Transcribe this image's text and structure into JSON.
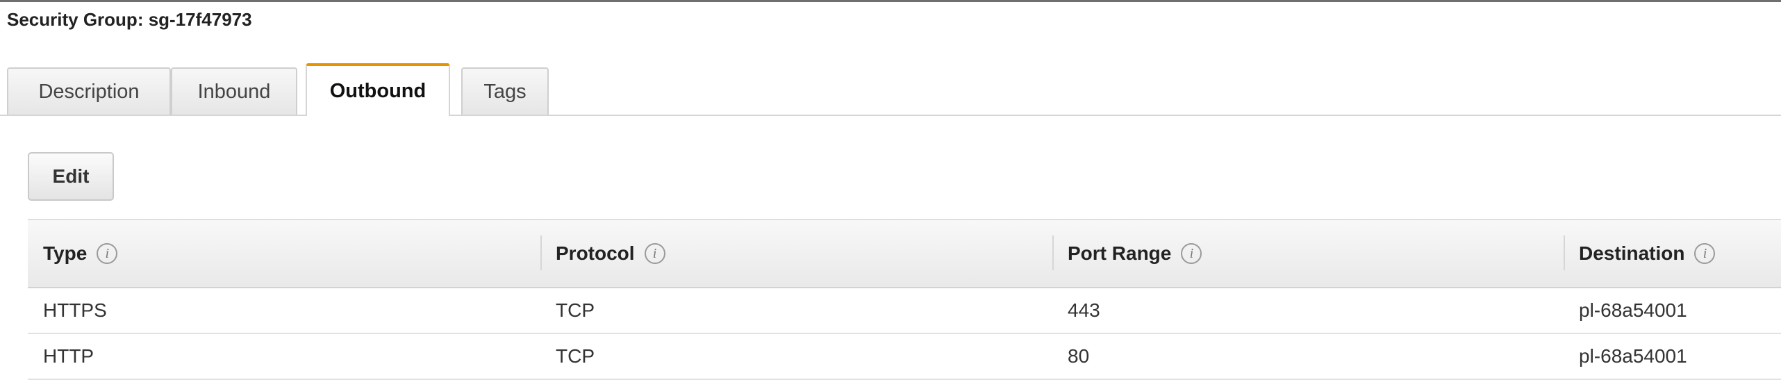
{
  "header": {
    "title": "Security Group: sg-17f47973"
  },
  "tabs": [
    {
      "label": "Description",
      "active": false
    },
    {
      "label": "Inbound",
      "active": false
    },
    {
      "label": "Outbound",
      "active": true
    },
    {
      "label": "Tags",
      "active": false
    }
  ],
  "toolbar": {
    "edit_label": "Edit"
  },
  "table": {
    "info_glyph": "i",
    "columns": [
      "Type",
      "Protocol",
      "Port Range",
      "Destination"
    ],
    "rows": [
      [
        "HTTPS",
        "TCP",
        "443",
        "pl-68a54001"
      ],
      [
        "HTTP",
        "TCP",
        "80",
        "pl-68a54001"
      ]
    ]
  },
  "colors": {
    "active_tab_accent": "#e69500"
  },
  "icons": {
    "column_info": "info-circle-icon"
  }
}
